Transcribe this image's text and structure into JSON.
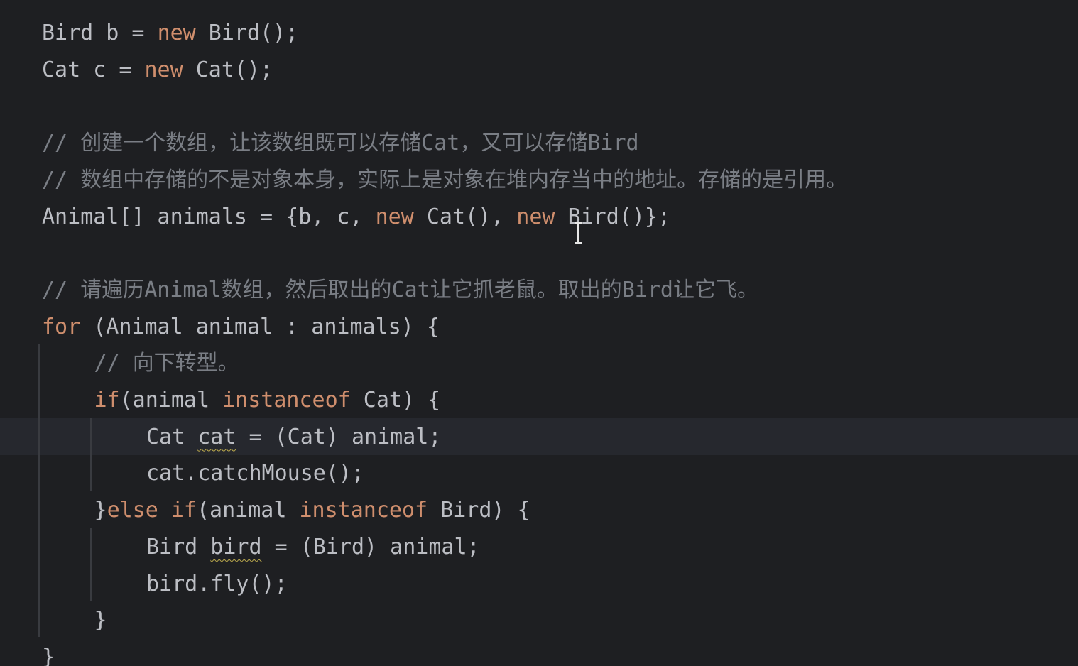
{
  "editor": {
    "lines": [
      {
        "tokens": [
          {
            "t": "Bird b = ",
            "k": "plain"
          },
          {
            "t": "new",
            "k": "kw"
          },
          {
            "t": " Bird();",
            "k": "plain"
          }
        ]
      },
      {
        "tokens": [
          {
            "t": "Cat c = ",
            "k": "plain"
          },
          {
            "t": "new",
            "k": "kw"
          },
          {
            "t": " Cat();",
            "k": "plain"
          }
        ]
      },
      {
        "tokens": []
      },
      {
        "tokens": [
          {
            "t": "// ",
            "k": "cm"
          },
          {
            "t": "创建一个数组，让该数组既可以存储",
            "k": "cmcjk"
          },
          {
            "t": "Cat",
            "k": "cm"
          },
          {
            "t": "，又可以存储",
            "k": "cmcjk"
          },
          {
            "t": "Bird",
            "k": "cm"
          }
        ]
      },
      {
        "tokens": [
          {
            "t": "// ",
            "k": "cm"
          },
          {
            "t": "数组中存储的不是对象本身，实际上是对象在堆内存当中的地址。存储的是引用。",
            "k": "cmcjk"
          }
        ]
      },
      {
        "tokens": [
          {
            "t": "Animal[] animals = {b, c, ",
            "k": "plain"
          },
          {
            "t": "new",
            "k": "kw"
          },
          {
            "t": " Cat(), ",
            "k": "plain"
          },
          {
            "t": "new",
            "k": "kw"
          },
          {
            "t": " Bird()};",
            "k": "plain"
          }
        ]
      },
      {
        "tokens": []
      },
      {
        "tokens": [
          {
            "t": "// ",
            "k": "cm"
          },
          {
            "t": "请遍历",
            "k": "cmcjk"
          },
          {
            "t": "Animal",
            "k": "cm"
          },
          {
            "t": "数组，然后取出的",
            "k": "cmcjk"
          },
          {
            "t": "Cat",
            "k": "cm"
          },
          {
            "t": "让它抓老鼠。取出的",
            "k": "cmcjk"
          },
          {
            "t": "Bird",
            "k": "cm"
          },
          {
            "t": "让它飞。",
            "k": "cmcjk"
          }
        ]
      },
      {
        "tokens": [
          {
            "t": "for",
            "k": "kw"
          },
          {
            "t": " (Animal animal : animals) {",
            "k": "plain"
          }
        ]
      },
      {
        "indent": 1,
        "tokens": [
          {
            "t": "// ",
            "k": "cm"
          },
          {
            "t": "向下转型。",
            "k": "cmcjk"
          }
        ]
      },
      {
        "indent": 1,
        "tokens": [
          {
            "t": "if",
            "k": "kw"
          },
          {
            "t": "(animal ",
            "k": "plain"
          },
          {
            "t": "instanceof",
            "k": "kw"
          },
          {
            "t": " Cat) {",
            "k": "plain"
          }
        ]
      },
      {
        "indent": 2,
        "current": true,
        "tokens": [
          {
            "t": "Cat ",
            "k": "plain"
          },
          {
            "t": "cat",
            "k": "wavy"
          },
          {
            "t": " = (Cat) animal;",
            "k": "plain"
          }
        ]
      },
      {
        "indent": 2,
        "tokens": [
          {
            "t": "cat.catchMouse();",
            "k": "plain"
          }
        ]
      },
      {
        "indent": 1,
        "tokens": [
          {
            "t": "}",
            "k": "plain"
          },
          {
            "t": "else if",
            "k": "kw"
          },
          {
            "t": "(animal ",
            "k": "plain"
          },
          {
            "t": "instanceof",
            "k": "kw"
          },
          {
            "t": " Bird) {",
            "k": "plain"
          }
        ]
      },
      {
        "indent": 2,
        "tokens": [
          {
            "t": "Bird ",
            "k": "plain"
          },
          {
            "t": "bird",
            "k": "wavy"
          },
          {
            "t": " = (Bird) animal;",
            "k": "plain"
          }
        ]
      },
      {
        "indent": 2,
        "tokens": [
          {
            "t": "bird.fly();",
            "k": "plain"
          }
        ]
      },
      {
        "indent": 1,
        "tokens": [
          {
            "t": "}",
            "k": "plain"
          }
        ]
      },
      {
        "tokens": [
          {
            "t": "}",
            "k": "plain"
          }
        ]
      }
    ]
  },
  "colors": {
    "background": "#1e1f22",
    "current_line": "#26282e",
    "text": "#bcbec4",
    "keyword": "#cf8e6d",
    "comment": "#7a7e85",
    "indent_guide": "#393b40",
    "warning_underline": "#b8a64c"
  },
  "cursor": {
    "icon": "text-cursor-icon"
  }
}
